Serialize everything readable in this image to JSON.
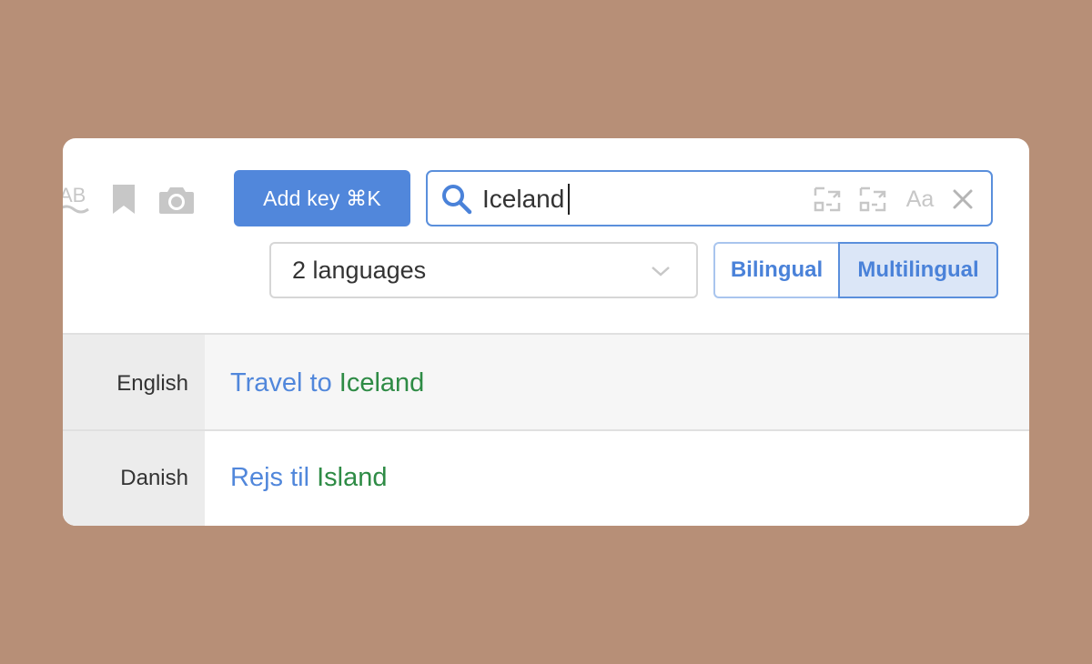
{
  "toolbar": {
    "icons": [
      "ab-translate-icon",
      "bookmark-icon",
      "camera-icon"
    ],
    "add_key_label": "Add key ⌘K"
  },
  "search": {
    "value": "Iceland",
    "actions": [
      "regex-icon",
      "regex-icon",
      "match-case-icon",
      "clear-icon"
    ],
    "case_label": "Aa"
  },
  "filters": {
    "languages_value": "2 languages",
    "mode_options": [
      "Bilingual",
      "Multilingual"
    ],
    "selected_mode": "Multilingual"
  },
  "rows": [
    {
      "language": "English",
      "text_before": "Travel to ",
      "text_match": "Iceland"
    },
    {
      "language": "Danish",
      "text_before": "Rejs til ",
      "text_match": "Island"
    }
  ],
  "colors": {
    "background": "#b78f77",
    "accent": "#5187db",
    "match": "#2e8b45",
    "selected_mode_bg": "#dbe6f7"
  }
}
